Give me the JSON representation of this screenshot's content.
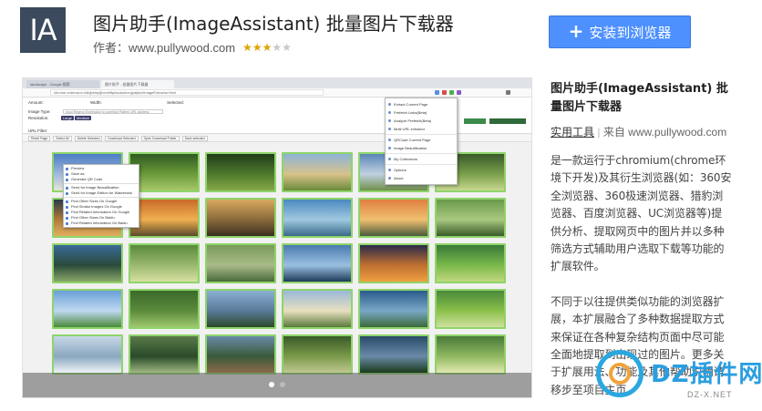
{
  "header": {
    "app_icon_text": "IA",
    "title": "图片助手(ImageAssistant) 批量图片下载器",
    "author": "作者：www.pullywood.com",
    "rating": 3,
    "rating_max": 5,
    "install_label": "安装到浏览器"
  },
  "screenshot": {
    "tabs": [
      "landscape - Google 搜索",
      "图片助手 - 批量图片下载器"
    ],
    "url": "chrome-extension://dbjbempljhcmhlfpfacalomonjpalpko/imageExtractor.html",
    "amount_label": "Amount:",
    "width_label": "Width:",
    "selected_label": "Selected:",
    "image_type_label": "Image Type:",
    "resolution_label": "Resolution:",
    "url_filter_label": "URL Filter:",
    "url_filter_placeholder": "Input Regexp Expression to pure/ban Pattern URL address",
    "action_buttons": [
      "Reset Page",
      "Select All",
      "Delete Selected",
      "Download Selected",
      "Open Download Folder",
      "Save selected"
    ],
    "context_menu": [
      "Preview",
      "Save as",
      "Generate QR Code",
      "Send for Image Beautification",
      "Send for Image Edition for Watermark",
      "Find Other Sizes On Google",
      "Find Similar Images On Google",
      "Find Related Information On Google",
      "Find Other Sizes On Baidu",
      "Find Related Information On Baidu"
    ],
    "extension_menu": [
      "Extract Current Page",
      "Prefetch Links(Beta)",
      "Analyze Prefetch(Beta)",
      "Multi URL extractor",
      "QRCode Current Page",
      "Image Beautification",
      "My Collections",
      "Options",
      "About"
    ],
    "slide_count": 2,
    "active_slide": 1
  },
  "side": {
    "title": "图片助手(ImageAssistant) 批量图片下载器",
    "category": "实用工具",
    "source": "来自 www.pullywood.com",
    "description_1": "是一款运行于chromium(chrome环境下开发)及其衍生浏览器(如：360安全浏览器、360极速浏览器、猎豹浏览器、百度浏览器、UC浏览器等)提供分析、提取网页中的图片并以多种筛选方式辅助用户选取下载等功能的扩展软件。",
    "description_2": "不同于以往提供类似功能的浏览器扩展，本扩展融合了多种数据提取方式来保证在各种复杂结构页面中尽可能全面地提取到出现过的图片。更多关于扩展用法、功能及其他帮助说明请移步至项目主页"
  },
  "watermark": {
    "text": "DZ插件网",
    "sub": "DZ-X.NET"
  },
  "colors": {
    "install_button": "#4d90fe",
    "app_icon_bg": "#3b4a5c",
    "thumb_border": "#8ed46a",
    "star": "#e0a400",
    "watermark_blue": "#2aa7e0",
    "watermark_orange": "#f2a33a"
  }
}
